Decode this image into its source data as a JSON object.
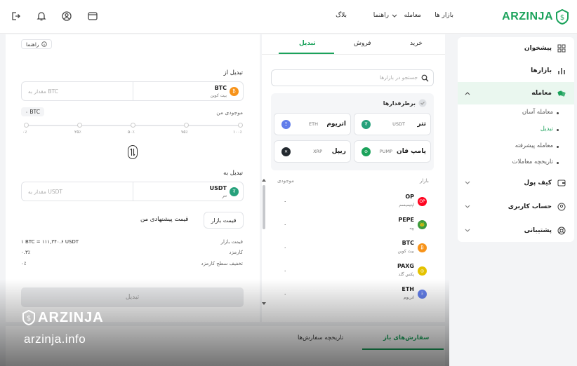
{
  "header": {
    "brand": "ARZINJA",
    "nav": [
      "بازار ها",
      "معامله",
      "راهنما",
      "بلاگ"
    ]
  },
  "sidebar": {
    "items": [
      "پیشخوان",
      "بازارها",
      "معامله",
      "کیف پول",
      "حساب کاربری",
      "پشتیبانی"
    ],
    "sub": [
      "معامله آسان",
      "تبدیل",
      "معامله پیشرفته",
      "تاریخچه معاملات"
    ]
  },
  "tabs": [
    "خرید",
    "فروش",
    "تبدیل"
  ],
  "guide": "راهنما",
  "search": {
    "placeholder": "جستجو در بازارها"
  },
  "favorites": {
    "title": "برطرفدارها",
    "items": [
      {
        "name": "تتر",
        "sym": "USDT",
        "color": "#26a17b",
        "glyph": "₮"
      },
      {
        "name": "اتریوم",
        "sym": "ETH",
        "color": "#627eea",
        "glyph": "Ξ"
      },
      {
        "name": "پامپ فان",
        "sym": "PUMP",
        "color": "#1ba25b",
        "glyph": "⊘"
      },
      {
        "name": "ریپل",
        "sym": "XRP",
        "color": "#23292f",
        "glyph": "✕"
      }
    ]
  },
  "market": {
    "col_market": "بازار",
    "col_balance": "موجودی",
    "rows": [
      {
        "sym": "OP",
        "name": "اپتیمیسم",
        "bal": "۰",
        "color": "#ff0420",
        "glyph": "OP"
      },
      {
        "sym": "PEPE",
        "name": "پپه",
        "bal": "۰",
        "color": "#3d9a3d",
        "glyph": "🐸"
      },
      {
        "sym": "BTC",
        "name": "بیت کوین",
        "bal": "۰",
        "color": "#f7931a",
        "glyph": "₿"
      },
      {
        "sym": "PAXG",
        "name": "پکس گلد",
        "bal": "۰",
        "color": "#e4c200",
        "glyph": "◎"
      },
      {
        "sym": "ETH",
        "name": "اتریوم",
        "bal": "۰",
        "color": "#627eea",
        "glyph": "Ξ"
      }
    ]
  },
  "convert": {
    "from_label": "تبدیل از",
    "from_sym": "BTC",
    "from_name": "بیت کوین",
    "from_placeholder": "مقدار به BTC",
    "balance_label": "موجودی من",
    "balance_val": "۰ BTC",
    "ticks": [
      "۰٪",
      "۲۵٪",
      "۵۰٪",
      "۷۵٪",
      "۱۰۰٪"
    ],
    "to_label": "تبدیل به",
    "to_sym": "USDT",
    "to_name": "تتر",
    "to_placeholder": "مقدار به USDT",
    "market_btn": "قیمت بازار",
    "suggest": "قیمت پیشنهادی من",
    "rows": [
      {
        "k": "قیمت بازار",
        "v": "۱ BTC = ۱۱۱,۳۴۰.۶ USDT"
      },
      {
        "k": "کارمزد",
        "v": "۰.۳٪"
      },
      {
        "k": "تخفیف سطح کارمزد",
        "v": "۰٪"
      }
    ],
    "submit": "تبدیل"
  },
  "bottom_tabs": [
    "سفارش‌های باز",
    "تاریخچه سفارش‌ها"
  ],
  "watermark": {
    "brand": "ARZINJA",
    "url": "arzinja.info"
  }
}
